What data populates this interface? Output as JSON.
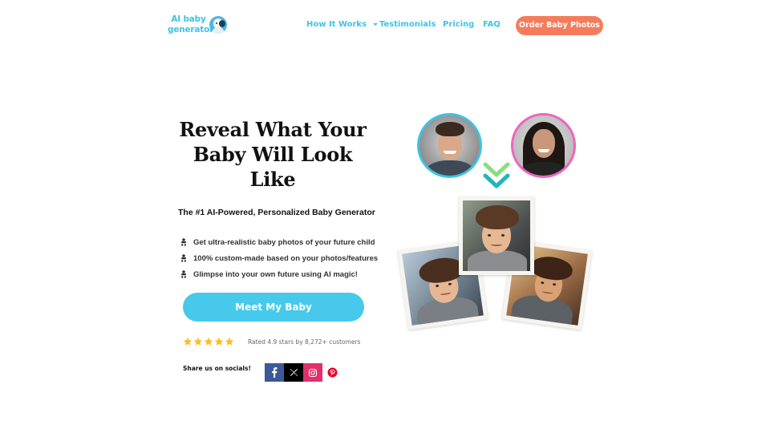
{
  "header": {
    "logo": {
      "line1": "AI baby",
      "line2": "generator"
    },
    "nav": [
      {
        "label": "How It Works",
        "has_dropdown": true
      },
      {
        "label": "Testimonials"
      },
      {
        "label": "Pricing"
      },
      {
        "label": "FAQ"
      }
    ],
    "order_button": "Order Baby Photos"
  },
  "hero": {
    "title_lines": [
      "Reveal What Your",
      "Baby Will Look",
      "Like"
    ],
    "subtitle": "The #1 AI-Powered, Personalized Baby Generator",
    "features": [
      "Get ultra-realistic baby photos of your future child",
      "100% custom-made based on your photos/features",
      "Glimpse into your own future using AI magic!"
    ],
    "cta": "Meet My Baby",
    "rating": {
      "stars": 5,
      "text": "Rated 4.9 stars by 8,272+ customers"
    },
    "share_label": "Share us on socials!",
    "socials": [
      {
        "name": "facebook",
        "glyph": "f",
        "color": "#3b5998"
      },
      {
        "name": "x",
        "glyph": "𝕏",
        "color": "#000000"
      },
      {
        "name": "instagram",
        "glyph": "ig",
        "color": "#e1306c"
      },
      {
        "name": "pinterest",
        "glyph": "P",
        "color": "#e60023"
      }
    ]
  },
  "visual": {
    "parents": [
      {
        "role": "father",
        "ring_color": "#3ec3e6"
      },
      {
        "role": "mother",
        "ring_color": "#f062c0"
      }
    ],
    "arrow_colors": [
      "#86e07f",
      "#1fb8b8"
    ],
    "baby_photos": [
      "left",
      "center",
      "right"
    ]
  },
  "colors": {
    "accent": "#3ec3e6",
    "order_button": "#f47c5c",
    "cta": "#46c9ea",
    "star": "#fbbf24"
  }
}
